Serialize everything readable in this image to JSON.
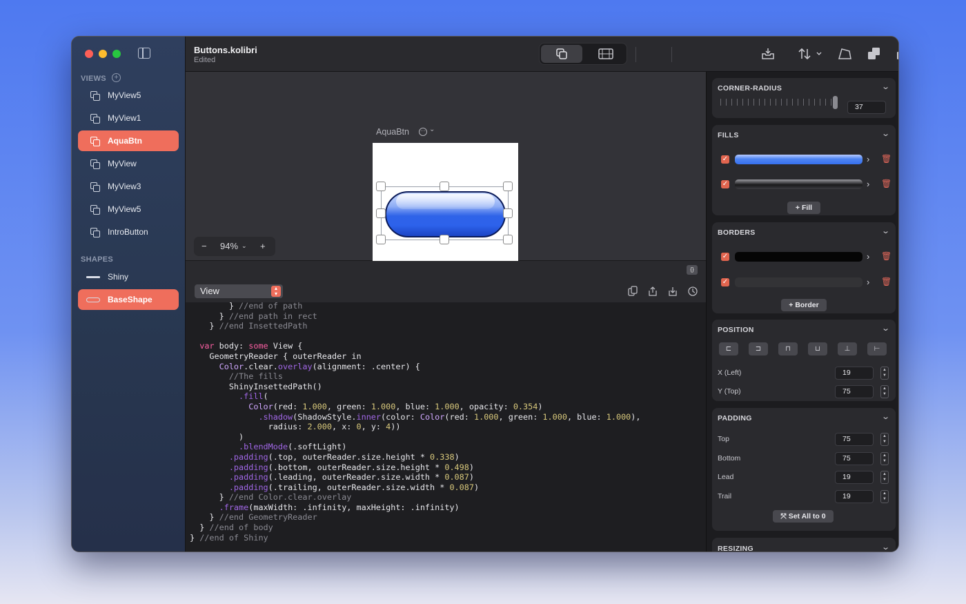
{
  "window": {
    "title": "Buttons.kolibri",
    "subtitle": "Edited"
  },
  "sidebar": {
    "views_header": "VIEWS",
    "views": [
      {
        "label": "MyView5",
        "selected": false
      },
      {
        "label": "MyView1",
        "selected": false
      },
      {
        "label": "AquaBtn",
        "selected": true
      },
      {
        "label": "MyView",
        "selected": false
      },
      {
        "label": "MyView3",
        "selected": false
      },
      {
        "label": "MyView5",
        "selected": false
      },
      {
        "label": "IntroButton",
        "selected": false
      }
    ],
    "shapes_header": "SHAPES",
    "shapes": [
      {
        "label": "Shiny",
        "selected": false
      },
      {
        "label": "BaseShape",
        "selected": true
      }
    ]
  },
  "toolbar": {
    "icons": [
      "views-mode-icon",
      "film-icon",
      "inbox-icon",
      "arrange-sort-icon",
      "shape-distort-icon",
      "union-icon",
      "subtract-icon",
      "intersect-icon",
      "exclude-icon",
      "add-icon"
    ]
  },
  "canvas": {
    "artboard_title": "AquaBtn",
    "zoom": "94%",
    "zoom_minus": "−",
    "zoom_plus": "+"
  },
  "code": {
    "view_picker": "View",
    "braces_label": "{}",
    "lines": [
      [
        [
          "        } ",
          "p"
        ],
        [
          "//end of path",
          "c"
        ]
      ],
      [
        [
          "      } ",
          "p"
        ],
        [
          "//end path in rect",
          "c"
        ]
      ],
      [
        [
          "    } ",
          "p"
        ],
        [
          "//end InsettedPath",
          "c"
        ]
      ],
      [
        [
          "",
          "p"
        ]
      ],
      [
        [
          "  ",
          "p"
        ],
        [
          "var",
          "k"
        ],
        [
          " body: ",
          "p"
        ],
        [
          "some",
          "k"
        ],
        [
          " View {",
          "p"
        ]
      ],
      [
        [
          "    GeometryReader { outerReader in",
          "p"
        ]
      ],
      [
        [
          "      Color",
          "t"
        ],
        [
          ".clear.",
          "p"
        ],
        [
          "overlay",
          "f"
        ],
        [
          "(alignment: .center) {",
          "p"
        ]
      ],
      [
        [
          "        ",
          "p"
        ],
        [
          "//The fills",
          "c"
        ]
      ],
      [
        [
          "        ShinyInsettedPath()",
          "p"
        ]
      ],
      [
        [
          "          ",
          "p"
        ],
        [
          ".fill",
          "f"
        ],
        [
          "(",
          "p"
        ]
      ],
      [
        [
          "            Color",
          "t"
        ],
        [
          "(red: ",
          "p"
        ],
        [
          "1.000",
          "n"
        ],
        [
          ", green: ",
          "p"
        ],
        [
          "1.000",
          "n"
        ],
        [
          ", blue: ",
          "p"
        ],
        [
          "1.000",
          "n"
        ],
        [
          ", opacity: ",
          "p"
        ],
        [
          "0.354",
          "n"
        ],
        [
          ")",
          "p"
        ]
      ],
      [
        [
          "              ",
          "p"
        ],
        [
          ".shadow",
          "f"
        ],
        [
          "(ShadowStyle.",
          "p"
        ],
        [
          "inner",
          "f"
        ],
        [
          "(color: ",
          "p"
        ],
        [
          "Color",
          "t"
        ],
        [
          "(red: ",
          "p"
        ],
        [
          "1.000",
          "n"
        ],
        [
          ", green: ",
          "p"
        ],
        [
          "1.000",
          "n"
        ],
        [
          ", blue: ",
          "p"
        ],
        [
          "1.000",
          "n"
        ],
        [
          "),",
          "p"
        ]
      ],
      [
        [
          "                radius: ",
          "p"
        ],
        [
          "2.000",
          "n"
        ],
        [
          ", x: ",
          "p"
        ],
        [
          "0",
          "n"
        ],
        [
          ", y: ",
          "p"
        ],
        [
          "4",
          "n"
        ],
        [
          "))",
          "p"
        ]
      ],
      [
        [
          "          )",
          "p"
        ]
      ],
      [
        [
          "          ",
          "p"
        ],
        [
          ".blendMode",
          "f"
        ],
        [
          "(.softLight)",
          "p"
        ]
      ],
      [
        [
          "        ",
          "p"
        ],
        [
          ".padding",
          "f"
        ],
        [
          "(.top, outerReader.size.height * ",
          "p"
        ],
        [
          "0.338",
          "n"
        ],
        [
          ")",
          "p"
        ]
      ],
      [
        [
          "        ",
          "p"
        ],
        [
          ".padding",
          "f"
        ],
        [
          "(.bottom, outerReader.size.height * ",
          "p"
        ],
        [
          "0.498",
          "n"
        ],
        [
          ")",
          "p"
        ]
      ],
      [
        [
          "        ",
          "p"
        ],
        [
          ".padding",
          "f"
        ],
        [
          "(.leading, outerReader.size.width * ",
          "p"
        ],
        [
          "0.087",
          "n"
        ],
        [
          ")",
          "p"
        ]
      ],
      [
        [
          "        ",
          "p"
        ],
        [
          ".padding",
          "f"
        ],
        [
          "(.trailing, outerReader.size.width * ",
          "p"
        ],
        [
          "0.087",
          "n"
        ],
        [
          ")",
          "p"
        ]
      ],
      [
        [
          "      } ",
          "p"
        ],
        [
          "//end Color.clear.overlay",
          "c"
        ]
      ],
      [
        [
          "      ",
          "p"
        ],
        [
          ".frame",
          "f"
        ],
        [
          "(maxWidth: .infinity, maxHeight: .infinity)",
          "p"
        ]
      ],
      [
        [
          "    } ",
          "p"
        ],
        [
          "//end GeometryReader",
          "c"
        ]
      ],
      [
        [
          "  } ",
          "p"
        ],
        [
          "//end of body",
          "c"
        ]
      ],
      [
        [
          "} ",
          "p"
        ],
        [
          "//end of Shiny",
          "c"
        ]
      ]
    ]
  },
  "inspector": {
    "corner_radius": {
      "header": "CORNER-RADIUS",
      "value": "37"
    },
    "fills": {
      "header": "FILLS",
      "add_label": "Fill"
    },
    "borders": {
      "header": "BORDERS",
      "add_label": "Border"
    },
    "position": {
      "header": "POSITION",
      "x_label": "X (Left)",
      "x_value": "19",
      "y_label": "Y (Top)",
      "y_value": "75"
    },
    "padding": {
      "header": "PADDING",
      "top_label": "Top",
      "top_value": "75",
      "bottom_label": "Bottom",
      "bottom_value": "75",
      "lead_label": "Lead",
      "lead_value": "19",
      "trail_label": "Trail",
      "trail_value": "19",
      "reset_label": "Set All to 0"
    },
    "resizing": {
      "header": "RESIZING"
    }
  },
  "colors": {
    "accent": "#ef6e5c",
    "code_keyword": "#fc5fa3",
    "code_type": "#d0a8ff",
    "code_func": "#a167e6",
    "code_number": "#d9c97c",
    "code_comment": "#8a8a92"
  }
}
